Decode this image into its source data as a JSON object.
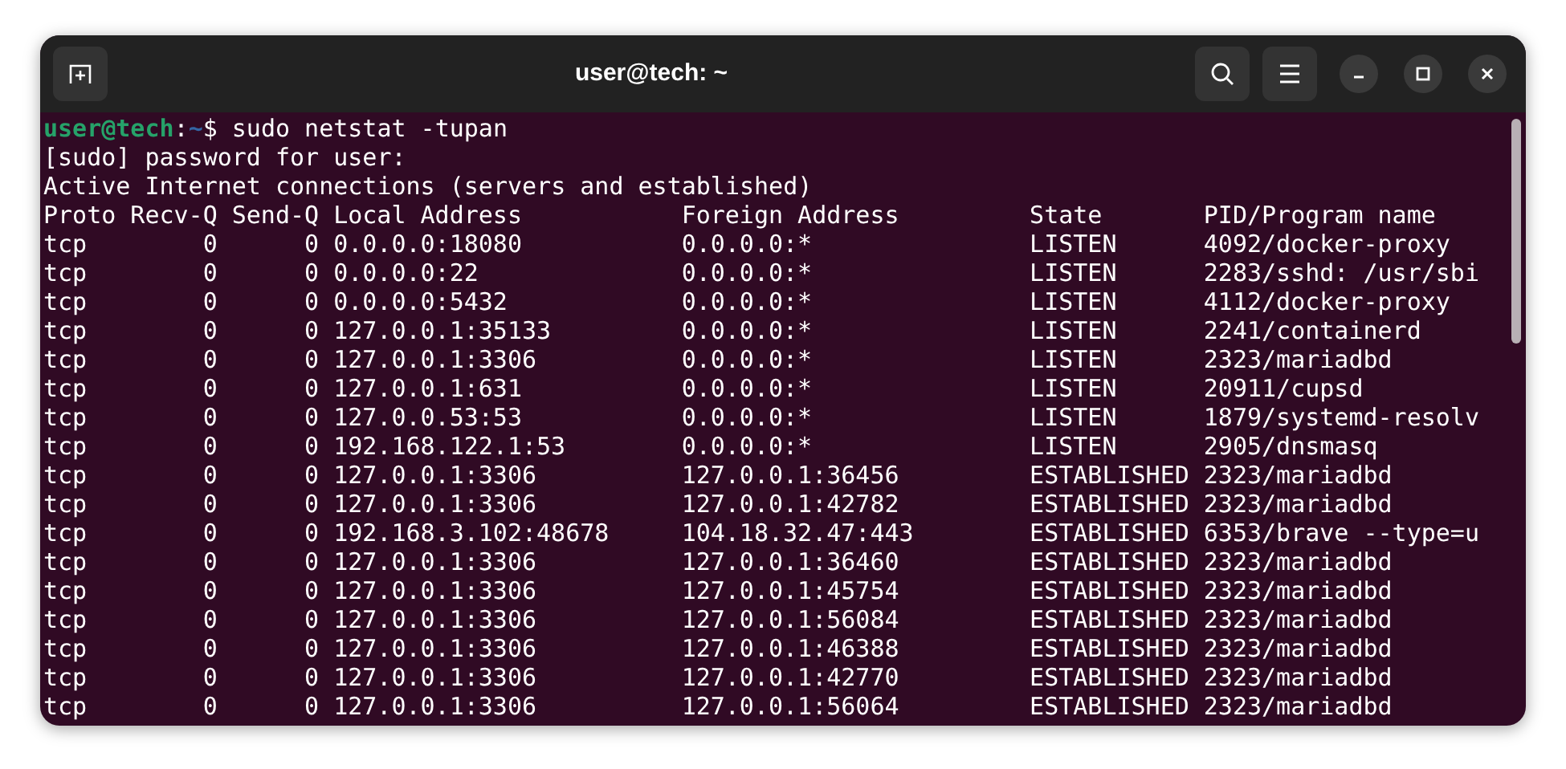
{
  "window": {
    "title": "user@tech: ~"
  },
  "prompt": {
    "user_host": "user@tech",
    "separator": ":",
    "path": "~",
    "symbol": "$",
    "command": "sudo netstat -tupan"
  },
  "output_lines": [
    "[sudo] password for user:",
    "Active Internet connections (servers and established)"
  ],
  "table": {
    "columns": [
      "Proto",
      "Recv-Q",
      "Send-Q",
      "Local Address",
      "Foreign Address",
      "State",
      "PID/Program name"
    ],
    "rows": [
      [
        "tcp",
        "0",
        "0",
        "0.0.0.0:18080",
        "0.0.0.0:*",
        "LISTEN",
        "4092/docker-proxy"
      ],
      [
        "tcp",
        "0",
        "0",
        "0.0.0.0:22",
        "0.0.0.0:*",
        "LISTEN",
        "2283/sshd: /usr/sbi"
      ],
      [
        "tcp",
        "0",
        "0",
        "0.0.0.0:5432",
        "0.0.0.0:*",
        "LISTEN",
        "4112/docker-proxy"
      ],
      [
        "tcp",
        "0",
        "0",
        "127.0.0.1:35133",
        "0.0.0.0:*",
        "LISTEN",
        "2241/containerd"
      ],
      [
        "tcp",
        "0",
        "0",
        "127.0.0.1:3306",
        "0.0.0.0:*",
        "LISTEN",
        "2323/mariadbd"
      ],
      [
        "tcp",
        "0",
        "0",
        "127.0.0.1:631",
        "0.0.0.0:*",
        "LISTEN",
        "20911/cupsd"
      ],
      [
        "tcp",
        "0",
        "0",
        "127.0.0.53:53",
        "0.0.0.0:*",
        "LISTEN",
        "1879/systemd-resolv"
      ],
      [
        "tcp",
        "0",
        "0",
        "192.168.122.1:53",
        "0.0.0.0:*",
        "LISTEN",
        "2905/dnsmasq"
      ],
      [
        "tcp",
        "0",
        "0",
        "127.0.0.1:3306",
        "127.0.0.1:36456",
        "ESTABLISHED",
        "2323/mariadbd"
      ],
      [
        "tcp",
        "0",
        "0",
        "127.0.0.1:3306",
        "127.0.0.1:42782",
        "ESTABLISHED",
        "2323/mariadbd"
      ],
      [
        "tcp",
        "0",
        "0",
        "192.168.3.102:48678",
        "104.18.32.47:443",
        "ESTABLISHED",
        "6353/brave --type=u"
      ],
      [
        "tcp",
        "0",
        "0",
        "127.0.0.1:3306",
        "127.0.0.1:36460",
        "ESTABLISHED",
        "2323/mariadbd"
      ],
      [
        "tcp",
        "0",
        "0",
        "127.0.0.1:3306",
        "127.0.0.1:45754",
        "ESTABLISHED",
        "2323/mariadbd"
      ],
      [
        "tcp",
        "0",
        "0",
        "127.0.0.1:3306",
        "127.0.0.1:56084",
        "ESTABLISHED",
        "2323/mariadbd"
      ],
      [
        "tcp",
        "0",
        "0",
        "127.0.0.1:3306",
        "127.0.0.1:46388",
        "ESTABLISHED",
        "2323/mariadbd"
      ],
      [
        "tcp",
        "0",
        "0",
        "127.0.0.1:3306",
        "127.0.0.1:42770",
        "ESTABLISHED",
        "2323/mariadbd"
      ],
      [
        "tcp",
        "0",
        "0",
        "127.0.0.1:3306",
        "127.0.0.1:56064",
        "ESTABLISHED",
        "2323/mariadbd"
      ]
    ]
  }
}
